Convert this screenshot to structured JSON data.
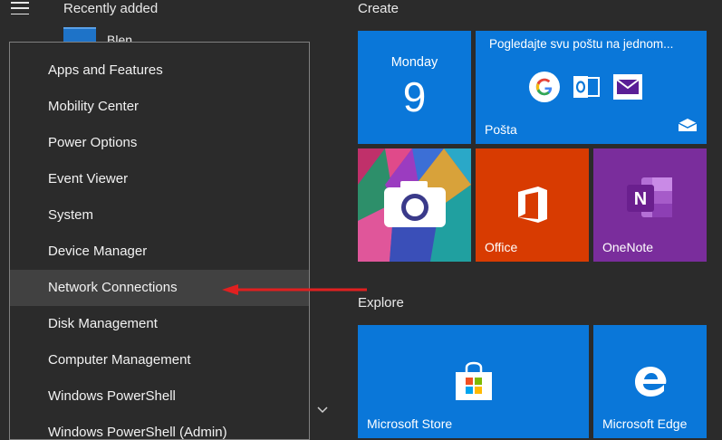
{
  "start": {
    "recently_added_label": "Recently added",
    "peek_app_label": "Blen...",
    "scroll_icon": "chevron-down-icon"
  },
  "context_menu": {
    "items": [
      {
        "label": "Apps and Features"
      },
      {
        "label": "Mobility Center"
      },
      {
        "label": "Power Options"
      },
      {
        "label": "Event Viewer"
      },
      {
        "label": "System"
      },
      {
        "label": "Device Manager"
      },
      {
        "label": "Network Connections",
        "highlighted": true
      },
      {
        "label": "Disk Management"
      },
      {
        "label": "Computer Management"
      },
      {
        "label": "Windows PowerShell"
      },
      {
        "label": "Windows PowerShell (Admin)"
      }
    ]
  },
  "annotation": {
    "arrow_color": "#e02020"
  },
  "tiles": {
    "create_title": "Create",
    "explore_title": "Explore",
    "calendar": {
      "day": "Monday",
      "date": "9"
    },
    "mail": {
      "headline": "Pogledajte svu poštu na jednom...",
      "label": "Pošta"
    },
    "office": {
      "label": "Office"
    },
    "onenote": {
      "label": "OneNote"
    },
    "store": {
      "label": "Microsoft Store"
    },
    "edge": {
      "label": "Microsoft Edge"
    }
  },
  "colors": {
    "tile_blue": "#0a77d9",
    "office": "#d83b01",
    "onenote": "#7a2d9c",
    "background": "#2b2b2b"
  }
}
